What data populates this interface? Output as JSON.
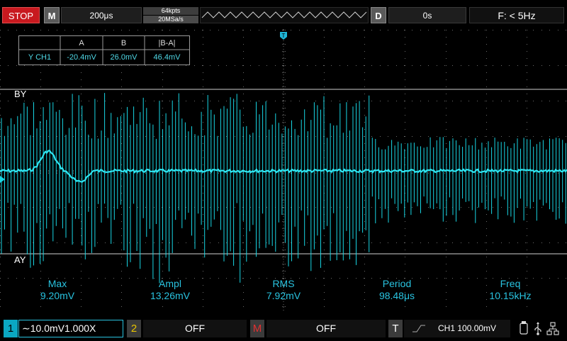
{
  "topbar": {
    "run_state": "STOP",
    "menu_label": "M",
    "timebase": "200μs",
    "memory_depth": "64kpts",
    "sample_rate": "20MSa/s",
    "delay_label": "D",
    "delay": "0s",
    "freq_counter": "F: < 5Hz"
  },
  "trigger_marker": "T",
  "cursor_table": {
    "headers": [
      "A",
      "B",
      "|B-A|"
    ],
    "row_label": "Y CH1",
    "values": [
      "-20.4mV",
      "26.0mV",
      "46.4mV"
    ]
  },
  "cursors": {
    "b_label": "BY",
    "a_label": "AY"
  },
  "measurements": [
    {
      "label": "Max",
      "value": "9.20mV"
    },
    {
      "label": "Ampl",
      "value": "13.26mV"
    },
    {
      "label": "RMS",
      "value": "7.92mV"
    },
    {
      "label": "Period",
      "value": "98.48μs"
    },
    {
      "label": "Freq",
      "value": "10.15kHz"
    }
  ],
  "bottombar": {
    "ch1_num": "1",
    "ch1_coupling": "∼",
    "ch1_scale": "10.0mV",
    "ch1_probe": "1.000X",
    "ch2_num": "2",
    "ch2_state": "OFF",
    "math_num": "M",
    "math_state": "OFF",
    "trig_num": "T",
    "trig_info": "CH1 100.00mV"
  },
  "colors": {
    "trace": "#18d6e4",
    "ch1": "#0ba7c2",
    "stop": "#c8191f",
    "grid": "#6a6a6a"
  }
}
